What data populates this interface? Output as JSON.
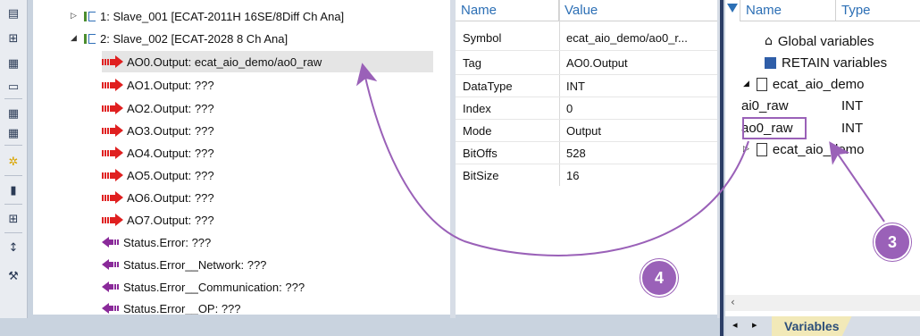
{
  "toolbar": {
    "icons": [
      "tree-view-icon",
      "network-icon",
      "config-icon",
      "folder-open-icon",
      "grid-icon",
      "grid-alt-icon",
      "sun-icon",
      "export-icon",
      "add-icon",
      "sort-icon",
      "wrench-icon"
    ]
  },
  "tree": {
    "rows": [
      {
        "label": "1: Slave_001 [ECAT-2011H 16SE/8Diff Ch Ana]",
        "type": "device",
        "expander": "▷"
      },
      {
        "label": "2: Slave_002 [ECAT-2028 8 Ch Ana]",
        "type": "device",
        "expander": "◢"
      },
      {
        "label": "AO0.Output: ecat_aio_demo/ao0_raw",
        "type": "out"
      },
      {
        "label": "AO1.Output: ???",
        "type": "out"
      },
      {
        "label": "AO2.Output: ???",
        "type": "out"
      },
      {
        "label": "AO3.Output: ???",
        "type": "out"
      },
      {
        "label": "AO4.Output: ???",
        "type": "out"
      },
      {
        "label": "AO5.Output: ???",
        "type": "out"
      },
      {
        "label": "AO6.Output: ???",
        "type": "out"
      },
      {
        "label": "AO7.Output: ???",
        "type": "out"
      },
      {
        "label": "Status.Error: ???",
        "type": "in"
      },
      {
        "label": "Status.Error__Network: ???",
        "type": "in"
      },
      {
        "label": "Status.Error__Communication: ???",
        "type": "in"
      },
      {
        "label": "Status.Error__OP: ???",
        "type": "in"
      }
    ]
  },
  "properties": {
    "headers": {
      "name": "Name",
      "value": "Value"
    },
    "rows": [
      {
        "name": "Symbol",
        "value": "ecat_aio_demo/ao0_r..."
      },
      {
        "name": "Tag",
        "value": "AO0.Output"
      },
      {
        "name": "DataType",
        "value": "INT"
      },
      {
        "name": "Index",
        "value": "0"
      },
      {
        "name": "Mode",
        "value": "Output"
      },
      {
        "name": "BitOffs",
        "value": "528"
      },
      {
        "name": "BitSize",
        "value": "16"
      }
    ]
  },
  "variables": {
    "headers": {
      "name": "Name",
      "type": "Type"
    },
    "global": "Global variables",
    "retain": "RETAIN variables",
    "group1": "ecat_aio_demo",
    "ai0_name": "ai0_raw",
    "ai0_type": "INT",
    "ao0_name": "ao0_raw",
    "ao0_type": "INT",
    "group2": "ecat_aio_demo"
  },
  "tabs": {
    "variables": "Variables"
  },
  "annotations": {
    "step3": "3",
    "step4": "4",
    "accent": "#9a61b8"
  }
}
